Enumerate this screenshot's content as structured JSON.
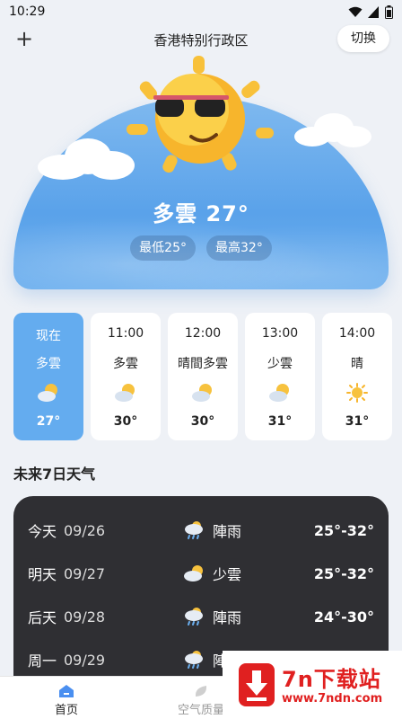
{
  "status_bar": {
    "time": "10:29"
  },
  "header": {
    "city": "香港特别行政区",
    "switch_label": "切换",
    "add_label": "+"
  },
  "current": {
    "condition_temp": "多雲 27°",
    "low": "最低25°",
    "high": "最高32°"
  },
  "hourly": [
    {
      "time": "现在",
      "desc": "多雲",
      "icon": "partly-cloudy-icon",
      "temp": "27°"
    },
    {
      "time": "11:00",
      "desc": "多雲",
      "icon": "partly-cloudy-icon",
      "temp": "30°"
    },
    {
      "time": "12:00",
      "desc": "晴間多雲",
      "icon": "partly-cloudy-icon",
      "temp": "30°"
    },
    {
      "time": "13:00",
      "desc": "少雲",
      "icon": "partly-cloudy-icon",
      "temp": "31°"
    },
    {
      "time": "14:00",
      "desc": "晴",
      "icon": "sun-icon",
      "temp": "31°"
    }
  ],
  "forecast_title": "未来7日天气",
  "forecast": [
    {
      "day": "今天",
      "date": "09/26",
      "icon": "rain-icon",
      "cond": "陣雨",
      "temp": "25°-32°"
    },
    {
      "day": "明天",
      "date": "09/27",
      "icon": "partly-cloudy-icon",
      "cond": "少雲",
      "temp": "25°-32°"
    },
    {
      "day": "后天",
      "date": "09/28",
      "icon": "rain-icon",
      "cond": "陣雨",
      "temp": "24°-30°"
    },
    {
      "day": "周一",
      "date": "09/29",
      "icon": "rain-icon",
      "cond": "陣雨",
      "temp": ""
    }
  ],
  "tabs": {
    "home": "首页",
    "air": "空气质量"
  },
  "watermark": {
    "title": "7n下载站",
    "url": "www.7ndn.com"
  },
  "colors": {
    "accent": "#64acef",
    "hero_sky": "#6aaeee",
    "week_bg": "#2f2f33",
    "brand_red": "#e02020"
  }
}
